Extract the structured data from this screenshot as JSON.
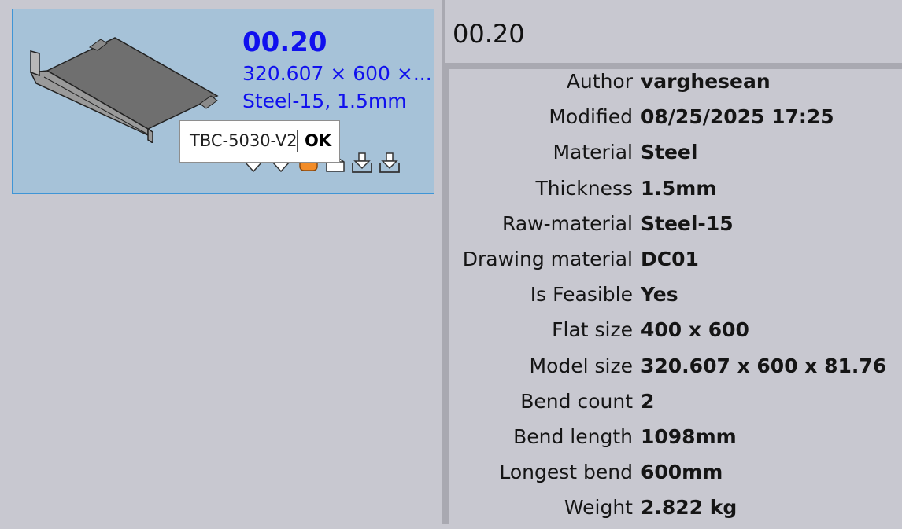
{
  "card": {
    "title": "00.20",
    "dimensions": "320.607 × 600 ×...",
    "material": "Steel-15, 1.5mm",
    "weight": "2.822 kg",
    "icons": [
      "bend-down-icon",
      "bend-down-icon",
      "bend-highlight-icon",
      "export-icon",
      "download-icon",
      "download-icon"
    ],
    "accent_selected": "#f28c28"
  },
  "tooltip": {
    "name": "TBC-5030-V2",
    "status": "OK"
  },
  "detail": {
    "title": "00.20",
    "properties": [
      {
        "label": "Author",
        "value": "varghesean"
      },
      {
        "label": "Modified",
        "value": "08/25/2025 17:25"
      },
      {
        "label": "Material",
        "value": "Steel"
      },
      {
        "label": "Thickness",
        "value": "1.5mm"
      },
      {
        "label": "Raw-material",
        "value": "Steel-15"
      },
      {
        "label": "Drawing material",
        "value": "DC01"
      },
      {
        "label": "Is Feasible",
        "value": "Yes"
      },
      {
        "label": "Flat size",
        "value": "400 x 600"
      },
      {
        "label": "Model size",
        "value": "320.607 x 600 x 81.76"
      },
      {
        "label": "Bend count",
        "value": "2"
      },
      {
        "label": "Bend length",
        "value": "1098mm"
      },
      {
        "label": "Longest bend",
        "value": "600mm"
      },
      {
        "label": "Weight",
        "value": "2.822 kg"
      }
    ]
  }
}
